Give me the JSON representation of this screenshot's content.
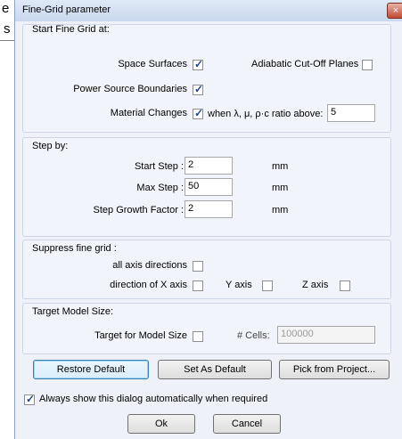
{
  "background_text": {
    "t1": "e",
    "t2": "s"
  },
  "dialog": {
    "title": "Fine-Grid parameter",
    "start_group": {
      "label": "Start Fine Grid at:",
      "space_surfaces": "Space Surfaces",
      "adiabatic": "Adiabatic Cut-Off Planes",
      "power_source": "Power Source Boundaries",
      "material_changes": "Material Changes",
      "when_ratio": "when λ, μ, ρ·c ratio above:",
      "ratio_value": "5"
    },
    "step_group": {
      "label": "Step by:",
      "start_step_label": "Start Step :",
      "start_step_value": "2",
      "max_step_label": "Max Step :",
      "max_step_value": "50",
      "growth_label": "Step Growth Factor :",
      "growth_value": "2",
      "unit": "mm"
    },
    "suppress_group": {
      "label": "Suppress fine grid :",
      "all_axis": "all axis directions",
      "x_axis": "direction of X axis",
      "y_axis": "Y axis",
      "z_axis": "Z axis"
    },
    "target_group": {
      "label": "Target Model Size:",
      "target_label": "Target for Model Size",
      "cells_label": "# Cells:",
      "cells_value": "100000"
    },
    "buttons": {
      "restore": "Restore Default",
      "set_default": "Set As Default",
      "pick": "Pick from Project...",
      "ok": "Ok",
      "cancel": "Cancel"
    },
    "always_show": "Always show this dialog automatically when required",
    "close_glyph": "×"
  }
}
